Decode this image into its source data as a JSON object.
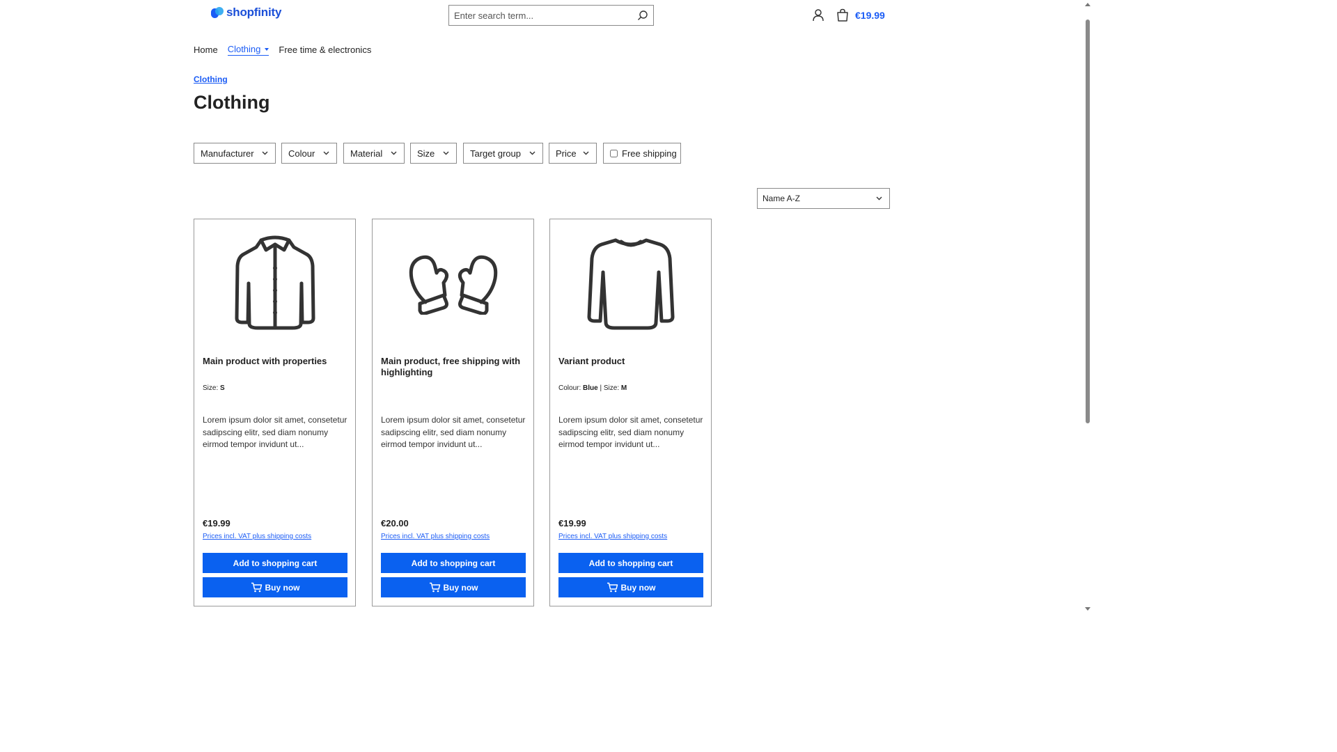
{
  "header": {
    "logo_text": "shopfinity",
    "search_placeholder": "Enter search term...",
    "cart_total": "€19.99"
  },
  "nav": {
    "items": [
      "Home",
      "Clothing",
      "Free time & electronics"
    ]
  },
  "breadcrumb": "Clothing",
  "page_title": "Clothing",
  "filters": [
    "Manufacturer",
    "Colour",
    "Material",
    "Size",
    "Target group",
    "Price"
  ],
  "free_shipping_label": "Free shipping",
  "sort": {
    "selected": "Name A-Z"
  },
  "products": [
    {
      "name": "Main product with properties",
      "props_label_1": "Size:",
      "props_value_1": "S",
      "description": "Lorem ipsum dolor sit amet, consetetur sadipscing elitr, sed diam nonumy eirmod tempor invidunt ut...",
      "price": "€19.99",
      "vat_text": "Prices incl. VAT plus shipping costs",
      "add_to_cart": "Add to shopping cart",
      "buy_now": "Buy now",
      "image_icon": "jacket-icon"
    },
    {
      "name": "Main product, free shipping with highlighting",
      "description": "Lorem ipsum dolor sit amet, consetetur sadipscing elitr, sed diam nonumy eirmod tempor invidunt ut...",
      "price": "€20.00",
      "vat_text": "Prices incl. VAT plus shipping costs",
      "add_to_cart": "Add to shopping cart",
      "buy_now": "Buy now",
      "image_icon": "mittens-icon"
    },
    {
      "name": "Variant product",
      "props_label_1": "Colour:",
      "props_value_1": "Blue",
      "props_label_2": "Size:",
      "props_value_2": "M",
      "description": "Lorem ipsum dolor sit amet, consetetur sadipscing elitr, sed diam nonumy eirmod tempor invidunt ut...",
      "price": "€19.99",
      "vat_text": "Prices incl. VAT plus shipping costs",
      "add_to_cart": "Add to shopping cart",
      "buy_now": "Buy now",
      "image_icon": "sweater-icon"
    }
  ],
  "colors": {
    "accent": "#0a61f0",
    "link": "#1b5cf5",
    "logo": "#1b4fd8"
  }
}
